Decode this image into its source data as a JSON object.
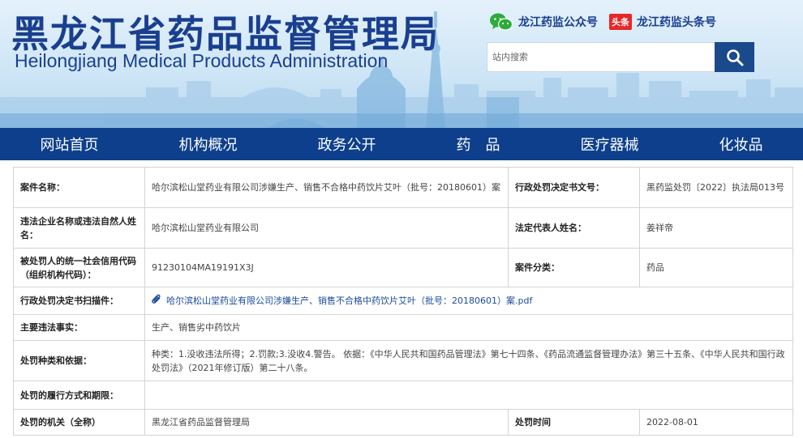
{
  "header": {
    "title_cn": "黑龙江省药品监督管理局",
    "title_en": "Heilongjiang Medical Products Administration",
    "wechat_label": "龙江药监公众号",
    "toutiao_badge": "头条",
    "toutiao_label": "龙江药监头条号",
    "brand_color": "#1a3f8f"
  },
  "search": {
    "placeholder": "站内搜索",
    "button_icon": "search-icon"
  },
  "nav": {
    "background": "#0d3f8c",
    "items": [
      "网站首页",
      "机构概况",
      "政务公开",
      "药　品",
      "医疗器械",
      "化妆品"
    ]
  },
  "case": {
    "case_name_label": "案件名称：",
    "case_name": "哈尔滨松山堂药业有限公司涉嫌生产、销售不合格中药饮片艾叶（批号：20180601）案",
    "decision_no_label": "行政处罚决定书文号：",
    "decision_no": "黑药监处罚〔2022〕执法局013号",
    "violator_label": "违法企业名称或违法自然人姓名：",
    "violator": "哈尔滨松山堂药业有限公司",
    "legal_rep_label": "法定代表人姓名：",
    "legal_rep": "姜祥帝",
    "credit_code_label": "被处罚人的统一社会信用代码（组织机构代码）：",
    "credit_code": "91230104MA19191X3J",
    "category_label": "案件分类：",
    "category": "药品",
    "scan_label": "行政处罚决定书扫描件：",
    "scan_file": "哈尔滨松山堂药业有限公司涉嫌生产、销售不合格中药饮片艾叶（批号：20180601）案.pdf",
    "facts_label": "主要违法事实：",
    "facts": "生产、销售劣中药饮片",
    "penalty_label": "处罚种类和依据：",
    "penalty": "种类：1.没收违法所得；2.罚款;3.没收4.警告。 依据：《中华人民共和国药品管理法》第七十四条、《药品流通监督管理办法》第三十五条、《中华人民共和国行政处罚法》（2021年修订版）第二十八条。",
    "performance_label": "处罚的履行方式和期限：",
    "performance": "",
    "authority_label": "处罚的机关（全称）",
    "authority": "黑龙江省药品监督管理局",
    "date_label": "处罚时间",
    "date": "2022-08-01"
  }
}
